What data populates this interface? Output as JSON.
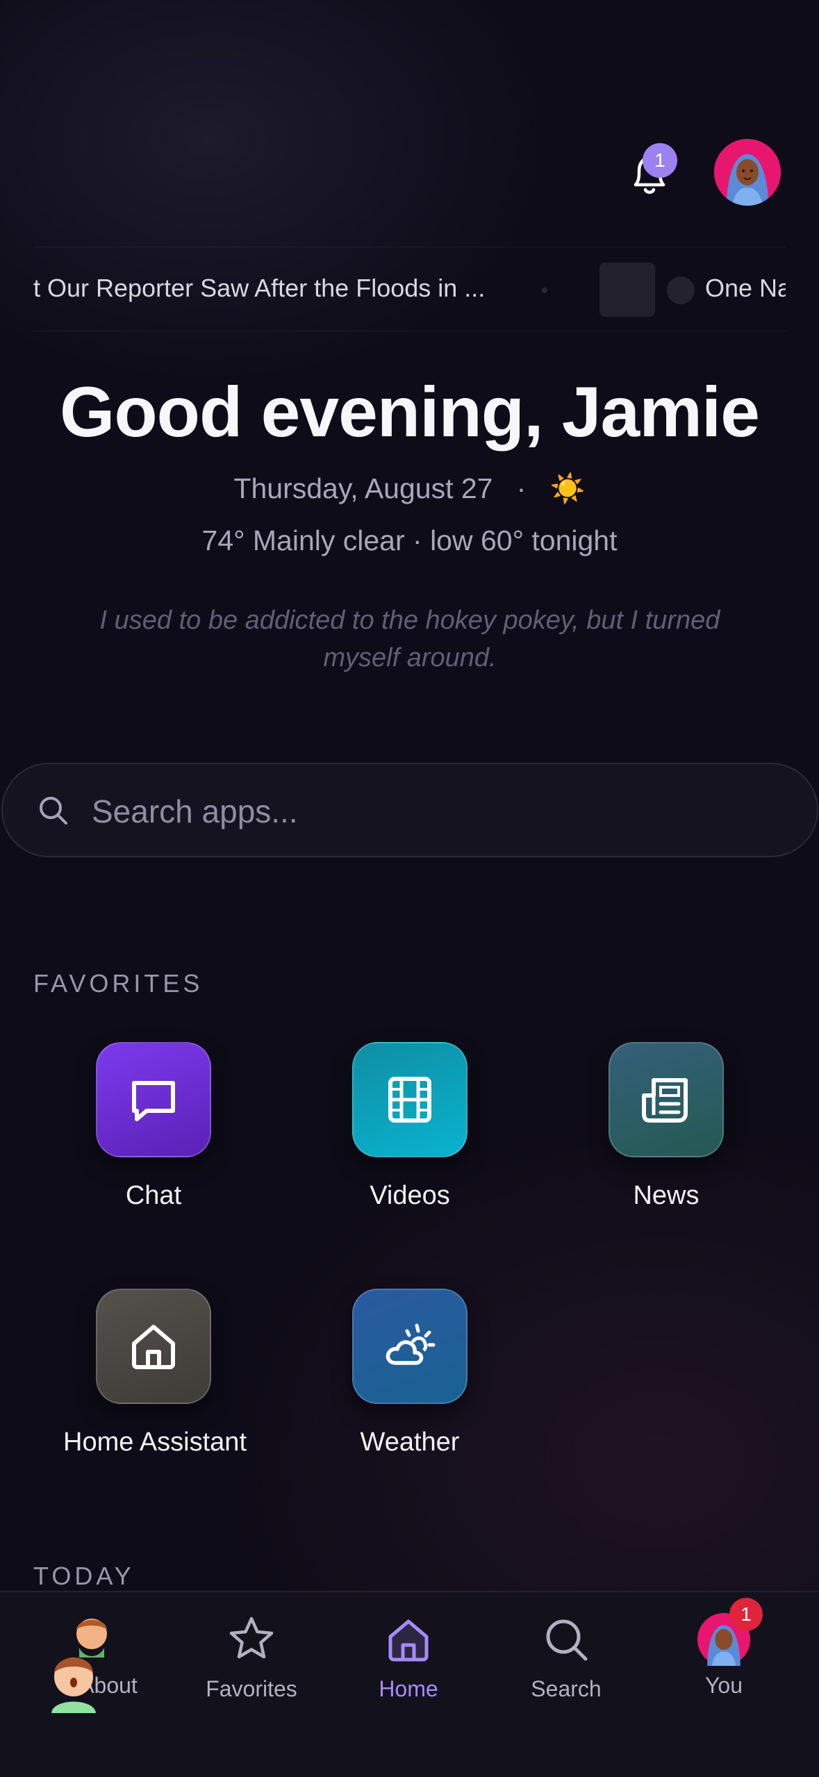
{
  "header": {
    "notification_count": "1",
    "bell_icon": "bell-icon",
    "avatar_icon": "user-avatar"
  },
  "ticker": {
    "headline_1": "t Our Reporter Saw After the Floods in ...",
    "headline_2": "One Na"
  },
  "greeting": {
    "title": "Good evening, Jamie",
    "date": "Thursday, August 27",
    "separator": "·",
    "sun_glyph": "☀️",
    "weather": "74° Mainly clear · low 60° tonight",
    "joke": "I used to be addicted to the hokey pokey, but I turned myself around."
  },
  "search": {
    "placeholder": "Search apps..."
  },
  "favorites": {
    "label": "FAVORITES",
    "apps": [
      {
        "label": "Chat",
        "icon": "chat-icon",
        "color": "#6d28d9"
      },
      {
        "label": "Videos",
        "icon": "film-icon",
        "color": "#0891b2"
      },
      {
        "label": "News",
        "icon": "newspaper-icon",
        "color": "#2f5d63"
      },
      {
        "label": "Home Assistant",
        "icon": "home-icon",
        "color": "#4a4742"
      },
      {
        "label": "Weather",
        "icon": "cloud-sun-icon",
        "color": "#1f5f96"
      }
    ]
  },
  "today": {
    "label": "TODAY"
  },
  "nav": {
    "items": [
      {
        "label": "About"
      },
      {
        "label": "Favorites"
      },
      {
        "label": "Home"
      },
      {
        "label": "Search"
      },
      {
        "label": "You"
      }
    ],
    "you_badge": "1",
    "active": "Home",
    "accent": "#a78bfa"
  }
}
